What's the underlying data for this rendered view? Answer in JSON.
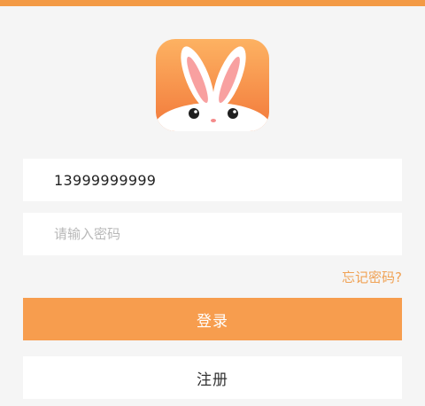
{
  "login": {
    "phone_value": "13999999999",
    "password_placeholder": "请输入密码",
    "forgot_password_label": "忘记密码?",
    "login_button_label": "登录",
    "register_button_label": "注册"
  },
  "colors": {
    "brand_orange": "#f79d4e",
    "link_orange": "#f0a255",
    "background": "#f5f5f5"
  },
  "icons": {
    "app_logo": "rabbit-icon"
  }
}
